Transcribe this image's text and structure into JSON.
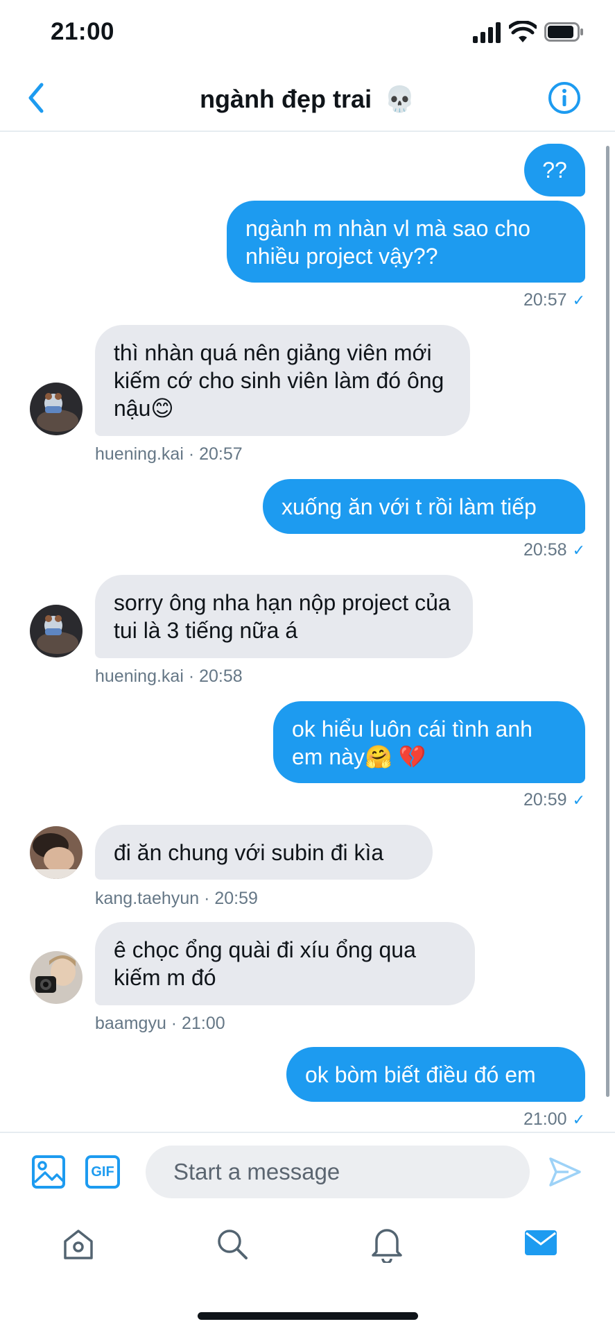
{
  "status_bar": {
    "time": "21:00"
  },
  "header": {
    "title": "ngành đẹp trai",
    "title_emoji": "💀"
  },
  "messages": [
    {
      "text": "??"
    },
    {
      "text": "ngành m nhàn vl mà sao cho nhiều project vậy??",
      "time": "20:57"
    },
    {
      "text": "thì nhàn quá nên giảng viên mới kiếm cớ cho sinh viên làm đó ông nậu😊",
      "meta": "huening.kai · 20:57"
    },
    {
      "text": "xuống ăn với t rồi làm tiếp",
      "time": "20:58"
    },
    {
      "text": "sorry ông nha hạn nộp project của tui là 3 tiếng nữa á",
      "meta": "huening.kai · 20:58"
    },
    {
      "text": "ok hiểu luôn cái tình anh em này🤗 💔",
      "time": "20:59"
    },
    {
      "text": "đi ăn chung với subin đi kìa",
      "meta": "kang.taehyun · 20:59"
    },
    {
      "text": "ê chọc ổng quài đi xíu ổng qua kiếm m đó",
      "meta": "baamgyu · 21:00"
    },
    {
      "text": "ok bòm biết điều đó em",
      "time": "21:00"
    }
  ],
  "read_mark": "✓",
  "composer": {
    "placeholder": "Start a message",
    "gif_label": "GIF"
  },
  "colors": {
    "accent": "#1d9bf0",
    "incoming_bubble": "#e7e9ee",
    "meta_text": "#657786"
  },
  "icons": {
    "back": "chevron-left-icon",
    "info": "info-icon",
    "image": "image-icon",
    "gif": "gif-icon",
    "send": "send-icon",
    "home": "home-icon",
    "search": "search-icon",
    "notifications": "bell-icon",
    "messages": "mail-icon"
  }
}
